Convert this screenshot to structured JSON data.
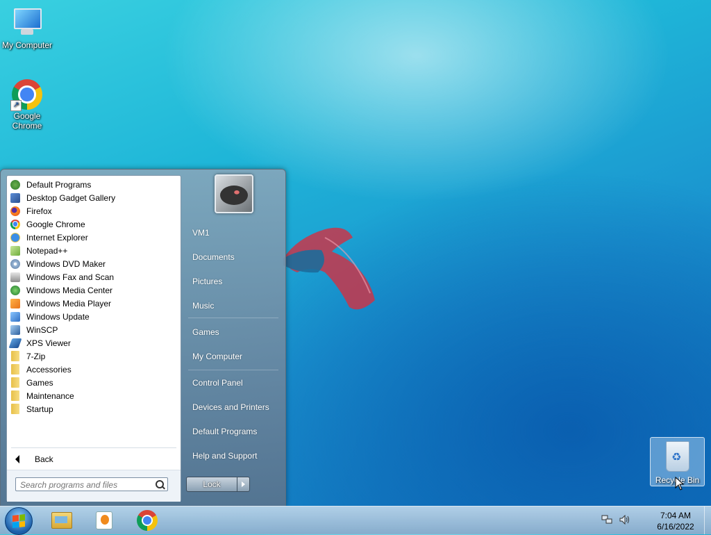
{
  "desktop": {
    "icons": [
      {
        "label": "My Computer"
      },
      {
        "label": "Google Chrome"
      }
    ],
    "recycle_bin": {
      "label": "Recycle Bin"
    }
  },
  "start_menu": {
    "programs": [
      {
        "label": "Default Programs",
        "icon": "default-programs-icon"
      },
      {
        "label": "Desktop Gadget Gallery",
        "icon": "gadget-gallery-icon"
      },
      {
        "label": "Firefox",
        "icon": "firefox-icon"
      },
      {
        "label": "Google Chrome",
        "icon": "chrome-icon"
      },
      {
        "label": "Internet Explorer",
        "icon": "internet-explorer-icon"
      },
      {
        "label": "Notepad++",
        "icon": "notepad-plus-plus-icon"
      },
      {
        "label": "Windows DVD Maker",
        "icon": "dvd-maker-icon"
      },
      {
        "label": "Windows Fax and Scan",
        "icon": "fax-scan-icon"
      },
      {
        "label": "Windows Media Center",
        "icon": "media-center-icon"
      },
      {
        "label": "Windows Media Player",
        "icon": "media-player-icon"
      },
      {
        "label": "Windows Update",
        "icon": "windows-update-icon"
      },
      {
        "label": "WinSCP",
        "icon": "winscp-icon"
      },
      {
        "label": "XPS Viewer",
        "icon": "xps-viewer-icon"
      },
      {
        "label": "7-Zip",
        "icon": "folder-icon"
      },
      {
        "label": "Accessories",
        "icon": "folder-icon"
      },
      {
        "label": "Games",
        "icon": "folder-icon"
      },
      {
        "label": "Maintenance",
        "icon": "folder-icon"
      },
      {
        "label": "Startup",
        "icon": "folder-icon"
      }
    ],
    "back_label": "Back",
    "search_placeholder": "Search programs and files",
    "right_links": [
      {
        "label": "VM1"
      },
      {
        "label": "Documents"
      },
      {
        "label": "Pictures"
      },
      {
        "label": "Music"
      },
      {
        "label": "Games"
      },
      {
        "label": "My Computer"
      },
      {
        "label": "Control Panel"
      },
      {
        "label": "Devices and Printers"
      },
      {
        "label": "Default Programs"
      },
      {
        "label": "Help and Support"
      }
    ],
    "lock_label": "Lock"
  },
  "taskbar": {
    "pinned": [
      {
        "name": "windows-explorer"
      },
      {
        "name": "windows-media-player"
      },
      {
        "name": "google-chrome"
      }
    ],
    "clock_time": "7:04 AM",
    "clock_date": "6/16/2022"
  },
  "colors": {
    "desktop_accent": "#1fb6d8",
    "taskbar": "#b4cfe6"
  }
}
